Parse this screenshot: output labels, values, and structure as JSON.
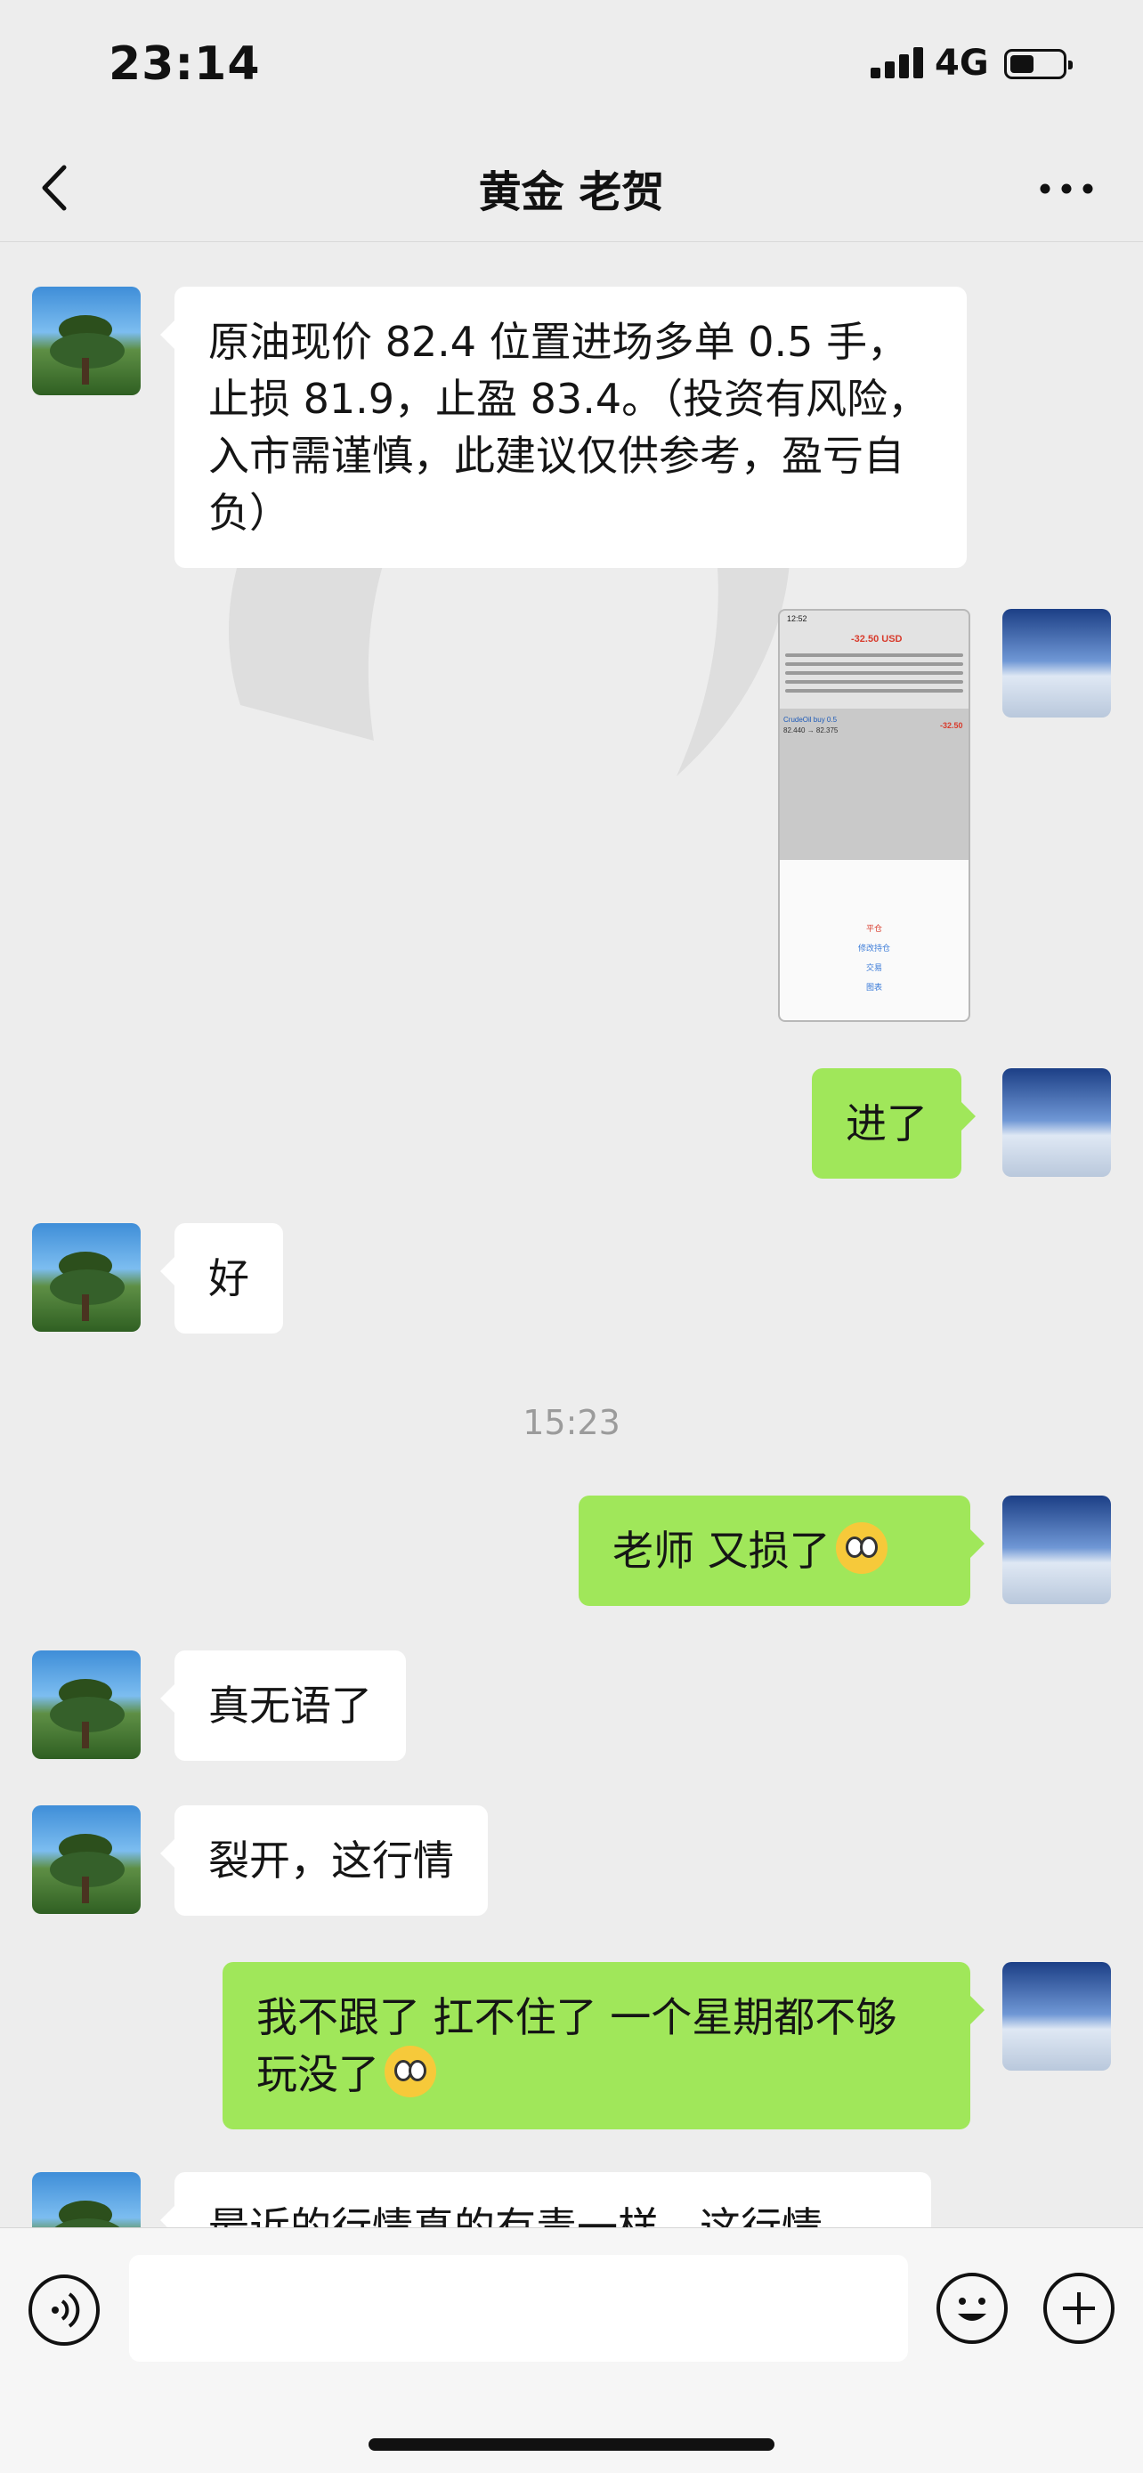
{
  "status_bar": {
    "time": "23:14",
    "network": "4G"
  },
  "nav": {
    "title": "黄金 老贺"
  },
  "messages": [
    {
      "from": "contact",
      "text": "原油现价 82.4 位置进场多单 0.5 手，止损 81.9，止盈 83.4。（投资有风险，入市需谨慎，此建议仅供参考，盈亏自负）"
    },
    {
      "from": "me",
      "type": "image",
      "image": {
        "time": "12:52",
        "amount": "-32.50 USD",
        "symbol": "CrudeOil buy 0.5",
        "price_range": "82.440 → 82.375",
        "pnl": "-32.50",
        "action_close": "平仓",
        "action_modify": "修改持仓",
        "action_trade": "交易",
        "action_chart": "图表"
      }
    },
    {
      "from": "me",
      "text": "进了"
    },
    {
      "from": "contact",
      "text": "好"
    },
    {
      "type": "time",
      "text": "15:23"
    },
    {
      "from": "me",
      "text": "老师 又损了"
    },
    {
      "from": "contact",
      "text": "真无语了"
    },
    {
      "from": "contact",
      "text": "裂开，这行情"
    },
    {
      "from": "me",
      "text": "我不跟了 扛不住了 一个星期都不够玩没了"
    },
    {
      "from": "contact",
      "text": "最近的行情真的有毒一样，这行情"
    }
  ],
  "icons": {
    "back": "chevron-left-icon",
    "more": "more-dots-icon",
    "voice": "voice-icon",
    "emoji": "emoji-icon",
    "plus": "plus-icon",
    "emoji_in_message": "dizzy-face-emoji"
  },
  "colors": {
    "background": "#ededed",
    "outgoing_bubble": "#a0e75a",
    "incoming_bubble": "#ffffff",
    "timestamp": "#9b9b9b"
  }
}
